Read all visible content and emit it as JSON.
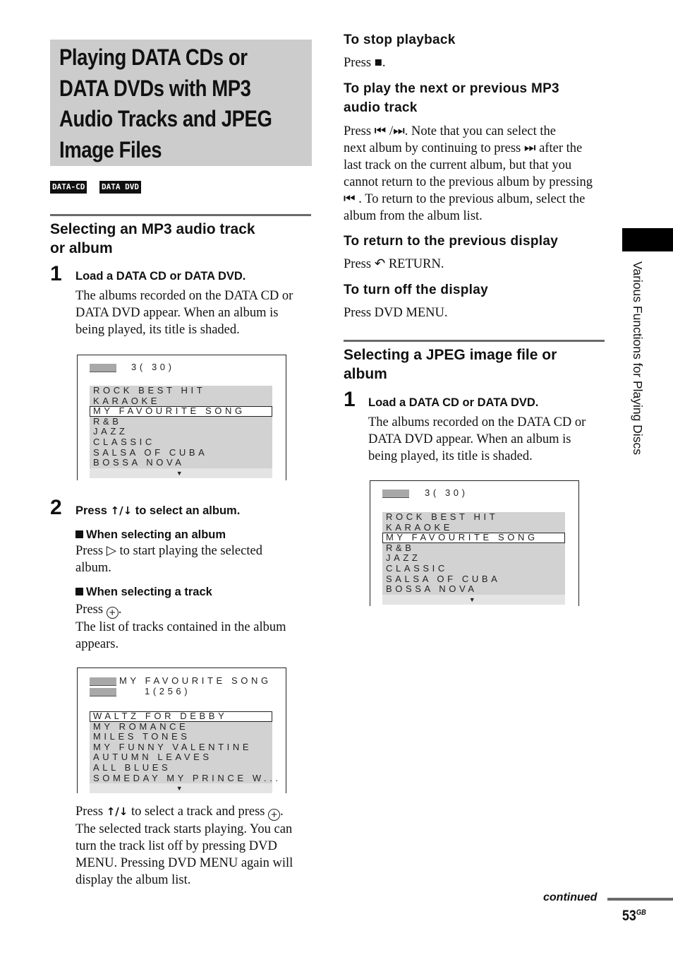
{
  "title": "Playing DATA CDs or DATA DVDs with MP3 Audio Tracks and JPEG Image Files",
  "title_lines": [
    "Playing DATA CDs or",
    "DATA DVDs with MP3",
    "Audio Tracks and JPEG",
    "Image Files"
  ],
  "badges": [
    "DATA-CD",
    "DATA DVD"
  ],
  "left": {
    "section_title_lines": [
      "Selecting an MP3 audio track",
      "or album"
    ],
    "step1": {
      "num": "1",
      "title": "Load a DATA CD or DATA DVD.",
      "body": [
        "The albums recorded on the DATA CD or",
        "DATA DVD appear. When an album is",
        "being played, its title is shaded."
      ]
    },
    "step2": {
      "num": "2",
      "title_pre": "Press ",
      "title_glyph": "↑/↓",
      "title_post": " to select an album.",
      "sub1": {
        "title": "When selecting an album",
        "line1_pre": "Press ",
        "line1_glyph": "▷",
        "line1_post": " to start playing the selected",
        "line2": "album."
      },
      "sub2": {
        "title": "When selecting a track",
        "line1_pre": "Press ",
        "line1_glyph": "+",
        "line1_post": ".",
        "body": [
          "The list of tracks contained in the album",
          "appears."
        ]
      }
    },
    "after": {
      "line1_pre": "Press ",
      "line1_glyph": "↑/↓",
      "line1_mid": " to select a track and press ",
      "line1_glyph2": "+",
      "line1_post": ".",
      "body": [
        "The selected track starts playing. You can",
        "turn the track list off by pressing DVD",
        "MENU. Pressing DVD MENU again will",
        "display the album list."
      ]
    }
  },
  "screen_albums": {
    "count": "3( 30)",
    "items": [
      "ROCK BEST HIT",
      "KARAOKE",
      "MY FAVOURITE SONG",
      "R&B",
      "JAZZ",
      "CLASSIC",
      "SALSA OF CUBA",
      "BOSSA NOVA"
    ],
    "selected_index": 2,
    "more": "▼"
  },
  "screen_tracks": {
    "album": "MY FAVOURITE SONG",
    "count": "1(256)",
    "items": [
      "WALTZ FOR DEBBY",
      "MY ROMANCE",
      "MILES TONES",
      "MY FUNNY VALENTINE",
      "AUTUMN LEAVES",
      "ALL BLUES",
      "SOMEDAY MY PRINCE W..."
    ],
    "selected_index": 0,
    "more": "▼"
  },
  "right": {
    "stop": {
      "title": "To stop playback",
      "pre": "Press ",
      "glyph": "■",
      "post": "."
    },
    "next_prev": {
      "title_lines": [
        "To play the next or previous MP3",
        "audio track"
      ],
      "body": [
        "Press ⏮ /⏭. Note that you can select the",
        "next album by continuing to press ⏭ after the",
        "last track on the current album, but that you",
        "cannot return to the previous album by pressing",
        "⏮ . To return to the previous album, select the",
        "album from the album list."
      ]
    },
    "return": {
      "title": "To return to the previous display",
      "pre": "Press ",
      "glyph": "↶",
      "post": " RETURN."
    },
    "off": {
      "title": "To turn off the display",
      "body": "Press DVD MENU."
    },
    "jpeg": {
      "section_title_lines": [
        "Selecting a JPEG image file or",
        "album"
      ],
      "step1": {
        "num": "1",
        "title": "Load a DATA CD or DATA DVD.",
        "body": [
          "The albums recorded on the DATA CD or",
          "DATA DVD appear. When an album is",
          "being played, its title is shaded."
        ]
      }
    }
  },
  "screen_albums_jpeg": {
    "count": "3( 30)",
    "items": [
      "ROCK BEST HIT",
      "KARAOKE",
      "MY FAVOURITE SONG",
      "R&B",
      "JAZZ",
      "CLASSIC",
      "SALSA OF CUBA",
      "BOSSA NOVA"
    ],
    "selected_index": 2,
    "more": "▼"
  },
  "side_tab": "Various Functions for Playing Discs",
  "footer": {
    "continued": "continued",
    "page": "53",
    "suffix": "GB"
  }
}
